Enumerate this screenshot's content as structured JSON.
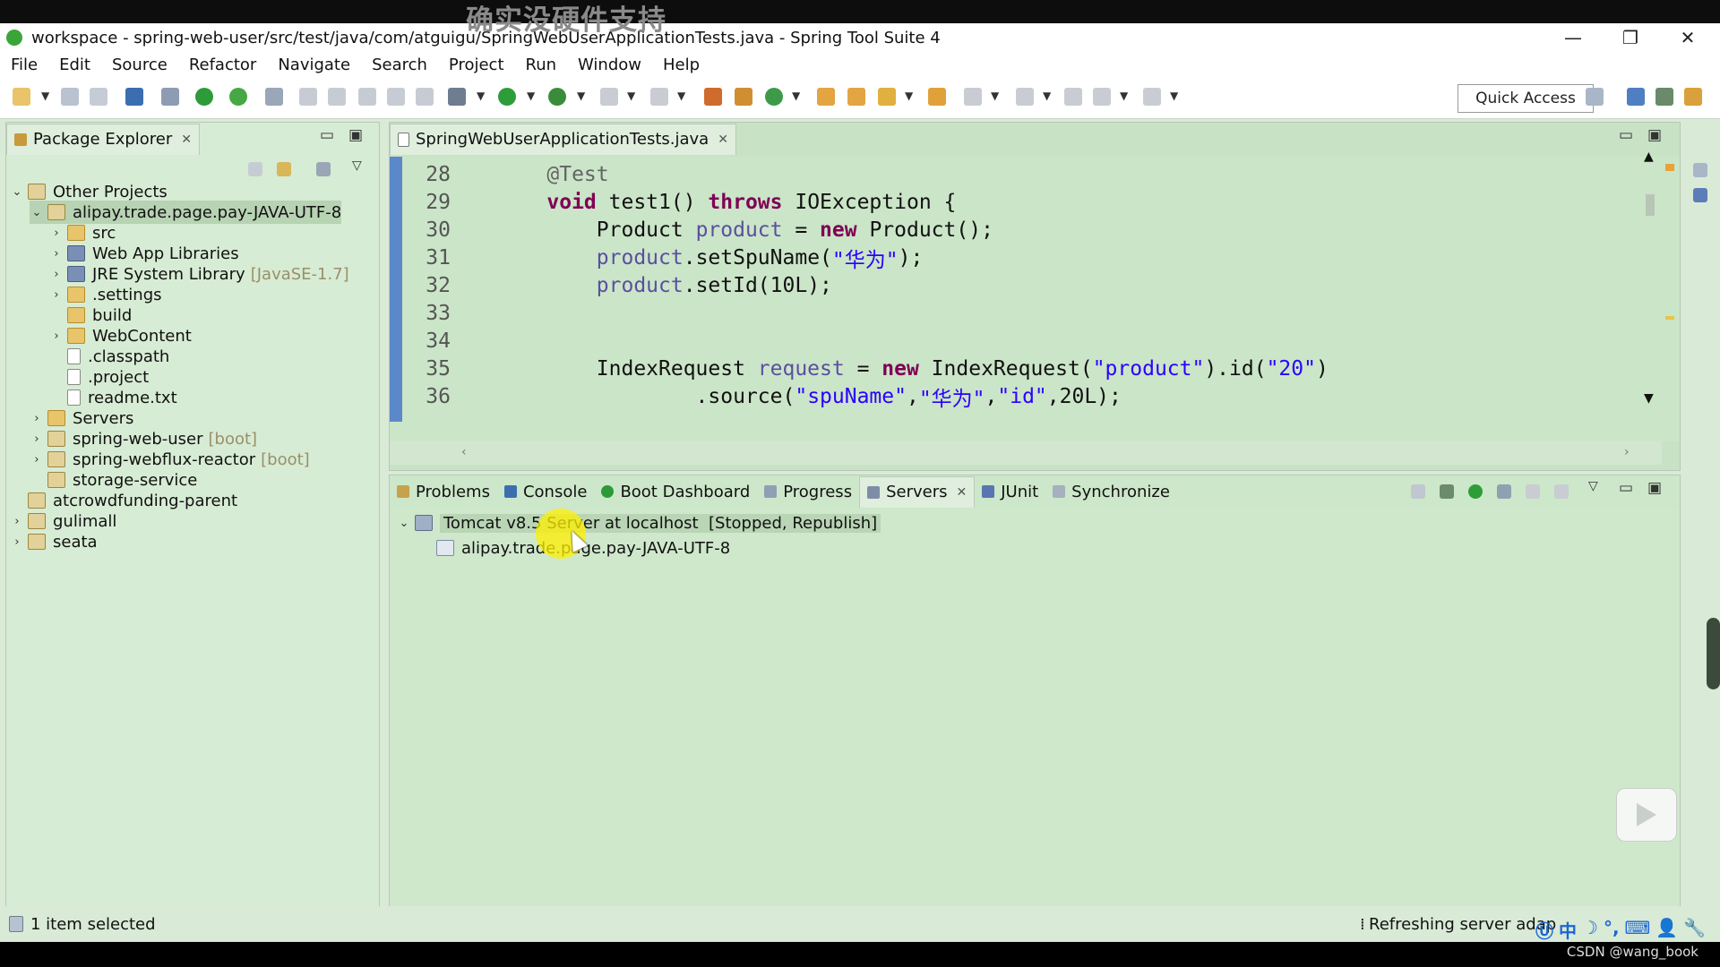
{
  "overlay_caption": "确实没硬件支持",
  "window": {
    "title": "workspace - spring-web-user/src/test/java/com/atguigu/SpringWebUserApplicationTests.java - Spring Tool Suite 4",
    "minimize": "—",
    "restore": "❐",
    "close": "✕"
  },
  "menu": [
    "File",
    "Edit",
    "Source",
    "Refactor",
    "Navigate",
    "Search",
    "Project",
    "Run",
    "Window",
    "Help"
  ],
  "toolbar": {
    "quick_access": "Quick Access"
  },
  "package_explorer": {
    "title": "Package Explorer",
    "tree": [
      {
        "label": "Other Projects",
        "tag": "",
        "level": 0,
        "expanded": true,
        "icon": "working-set-icon"
      },
      {
        "label": "alipay.trade.page.pay-JAVA-UTF-8",
        "tag": "",
        "level": 1,
        "expanded": true,
        "icon": "project-icon"
      },
      {
        "label": "src",
        "tag": "",
        "level": 2,
        "expanded": false,
        "icon": "source-folder-icon"
      },
      {
        "label": "Web App Libraries",
        "tag": "",
        "level": 2,
        "expanded": false,
        "icon": "library-icon"
      },
      {
        "label": "JRE System Library",
        "tag": "[JavaSE-1.7]",
        "level": 2,
        "expanded": false,
        "icon": "library-icon"
      },
      {
        "label": ".settings",
        "tag": "",
        "level": 2,
        "expanded": false,
        "icon": "folder-icon"
      },
      {
        "label": "build",
        "tag": "",
        "level": 2,
        "expanded": null,
        "icon": "folder-icon"
      },
      {
        "label": "WebContent",
        "tag": "",
        "level": 2,
        "expanded": false,
        "icon": "folder-icon"
      },
      {
        "label": ".classpath",
        "tag": "",
        "level": 2,
        "expanded": null,
        "icon": "xml-file-icon"
      },
      {
        "label": ".project",
        "tag": "",
        "level": 2,
        "expanded": null,
        "icon": "xml-file-icon"
      },
      {
        "label": "readme.txt",
        "tag": "",
        "level": 2,
        "expanded": null,
        "icon": "text-file-icon"
      },
      {
        "label": "Servers",
        "tag": "",
        "level": 1,
        "expanded": false,
        "icon": "folder-icon"
      },
      {
        "label": "spring-web-user",
        "tag": "[boot]",
        "level": 1,
        "expanded": false,
        "icon": "project-icon"
      },
      {
        "label": "spring-webflux-reactor",
        "tag": "[boot]",
        "level": 1,
        "expanded": false,
        "icon": "project-icon"
      },
      {
        "label": "storage-service",
        "tag": "",
        "level": 1,
        "expanded": null,
        "icon": "project-icon"
      },
      {
        "label": "atcrowdfunding-parent",
        "tag": "",
        "level": 0,
        "expanded": null,
        "icon": "working-set-icon"
      },
      {
        "label": "gulimall",
        "tag": "",
        "level": 0,
        "expanded": false,
        "icon": "working-set-icon"
      },
      {
        "label": "seata",
        "tag": "",
        "level": 0,
        "expanded": false,
        "icon": "working-set-icon"
      }
    ]
  },
  "editor": {
    "tab": "SpringWebUserApplicationTests.java",
    "lines": [
      {
        "no": "28",
        "tokens": [
          [
            "ann",
            "    @Test"
          ]
        ]
      },
      {
        "no": "29",
        "tokens": [
          [
            "",
            "    "
          ],
          [
            "kw",
            "void"
          ],
          [
            "",
            " test1() "
          ],
          [
            "kw",
            "throws"
          ],
          [
            "",
            " IOException {"
          ]
        ]
      },
      {
        "no": "30",
        "tokens": [
          [
            "",
            "        Product "
          ],
          [
            "fld",
            "product"
          ],
          [
            "",
            " = "
          ],
          [
            "kw",
            "new"
          ],
          [
            "",
            " Product();"
          ]
        ]
      },
      {
        "no": "31",
        "tokens": [
          [
            "",
            "        "
          ],
          [
            "fld",
            "product"
          ],
          [
            "",
            ".setSpuName("
          ],
          [
            "str",
            "\"华为\""
          ],
          [
            "",
            ");"
          ]
        ]
      },
      {
        "no": "32",
        "tokens": [
          [
            "",
            "        "
          ],
          [
            "fld",
            "product"
          ],
          [
            "",
            ".setId(10L);"
          ]
        ]
      },
      {
        "no": "33",
        "tokens": [
          [
            "",
            ""
          ]
        ]
      },
      {
        "no": "34",
        "tokens": [
          [
            "",
            ""
          ]
        ]
      },
      {
        "no": "35",
        "tokens": [
          [
            "",
            "        IndexRequest "
          ],
          [
            "fld",
            "request"
          ],
          [
            "",
            " = "
          ],
          [
            "kw",
            "new"
          ],
          [
            "",
            " IndexRequest("
          ],
          [
            "str",
            "\"product\""
          ],
          [
            "",
            ").id("
          ],
          [
            "str",
            "\"20\""
          ],
          [
            "",
            ")"
          ]
        ]
      },
      {
        "no": "36",
        "tokens": [
          [
            "",
            "                .source("
          ],
          [
            "str",
            "\"spuName\""
          ],
          [
            "",
            ","
          ],
          [
            "str",
            "\"华为\""
          ],
          [
            "",
            ","
          ],
          [
            "str",
            "\"id\""
          ],
          [
            "",
            ",20L);"
          ]
        ]
      }
    ]
  },
  "bottom_tabs": [
    "Problems",
    "Console",
    "Boot Dashboard",
    "Progress",
    "Servers",
    "JUnit",
    "Synchronize"
  ],
  "active_bottom_tab": "Servers",
  "servers": {
    "server": "Tomcat v8.5 Server at localhost",
    "state": "[Stopped, Republish]",
    "module": "alipay.trade.page.pay-JAVA-UTF-8"
  },
  "status": {
    "left": "1 item selected",
    "right": "Refreshing server adap"
  },
  "ime": [
    "中",
    "☽",
    "°,",
    "⌨",
    "👤",
    "🔧"
  ],
  "watermark": "CSDN @wang_book",
  "colors": {
    "background": "#d9ead7",
    "keyword": "#7f0055",
    "string": "#2a00ff",
    "field": "#5a4fa0",
    "gutter": "#5b88c9"
  }
}
